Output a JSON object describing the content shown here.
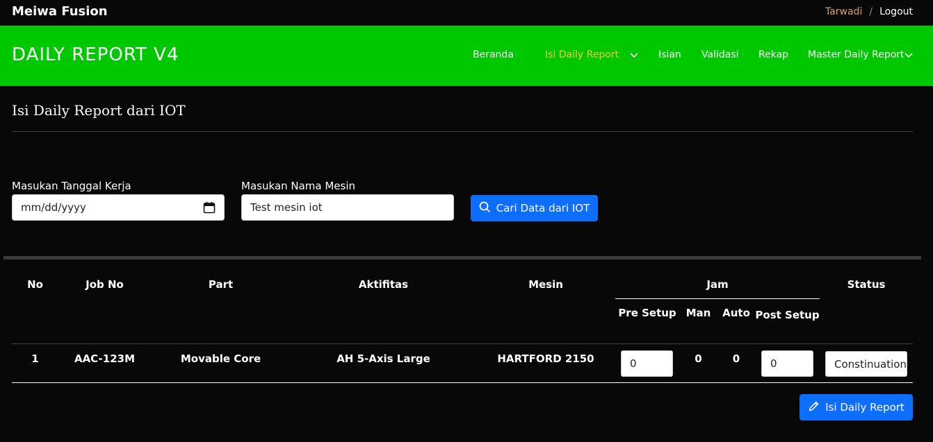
{
  "topbar": {
    "brand": "Meiwa Fusion",
    "user": "Tarwadi",
    "separator": "/",
    "logout": "Logout"
  },
  "navbar": {
    "title": "DAILY REPORT V4",
    "items": [
      {
        "label": "Beranda"
      },
      {
        "label": "Isi Daily Report",
        "active": true,
        "dropdown": true
      },
      {
        "label": "Isian"
      },
      {
        "label": "Validasi"
      },
      {
        "label": "Rekap"
      },
      {
        "label": "Master Daily Report",
        "dropdown": true
      }
    ],
    "colors": {
      "bar": "#00c800",
      "active": "#f2c44b"
    }
  },
  "page": {
    "title": "Isi Daily Report dari IOT"
  },
  "form": {
    "date_label": "Masukan Tanggal Kerja",
    "date_placeholder": "mm/dd/yyyy",
    "machine_label": "Masukan Nama Mesin",
    "machine_value": "Test mesin iot",
    "search_button": "Cari Data dari IOT",
    "search_icon": "search-icon"
  },
  "table": {
    "headers": {
      "no": "No",
      "job_no": "Job No",
      "part": "Part",
      "aktifitas": "Aktifitas",
      "mesin": "Mesin",
      "jam": "Jam",
      "status": "Status"
    },
    "jam_headers": {
      "pre_setup": "Pre Setup",
      "man": "Man",
      "auto": "Auto",
      "post_setup": "Post Setup"
    },
    "rows": [
      {
        "no": "1",
        "job_no": "AAC-123M",
        "part": "Movable Core",
        "aktifitas": "AH 5-Axis Large",
        "mesin": "HARTFORD 2150",
        "pre_setup": "0",
        "man": "0",
        "auto": "0",
        "post_setup": "0",
        "status": "Constinuation"
      }
    ]
  },
  "actions": {
    "submit_button": "Isi Daily Report",
    "submit_icon": "pencil-icon",
    "accent": "#0d6efd"
  }
}
